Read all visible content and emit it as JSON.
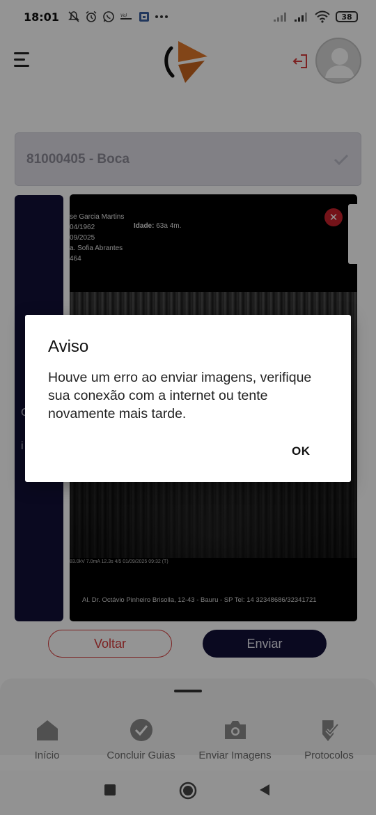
{
  "status_bar": {
    "time": "18:01",
    "battery": "38",
    "icons": [
      "do-not-disturb-icon",
      "alarm-icon",
      "whatsapp-icon",
      "wifi-calling-icon",
      "screen-cast-icon",
      "more-dots-icon",
      "signal-weak-icon",
      "signal-icon",
      "wifi-icon",
      "battery-icon"
    ]
  },
  "header": {
    "menu_icon": "hamburger-menu-icon",
    "logo": "brand-logo",
    "logout_icon": "logout-icon",
    "avatar_icon": "user-avatar-icon"
  },
  "procedure": {
    "title": "81000405 - Boca",
    "check_icon": "check-icon"
  },
  "left_panel": {
    "text1": "C",
    "text2": "i"
  },
  "xray": {
    "patient_name": "se Garcia Martins",
    "birth_date": "04/1962",
    "exam_date": "09/2025",
    "doctor": "a. Sofia Abrantes",
    "code": "464",
    "age_label": "Idade:",
    "age_value": "63a 4m.",
    "params": "83.0kV 7.0mA 12.3s 4/5 01/09/2025 09:32 (T)",
    "footer": "Al. Dr. Octávio Pinheiro Brisolla, 12-43 - Bauru - SP Tel: 14 32348686/32341721",
    "close_symbol": "✕"
  },
  "buttons": {
    "back": "Voltar",
    "send": "Enviar"
  },
  "bottom_nav": [
    {
      "label": "Início",
      "icon": "home-icon"
    },
    {
      "label": "Concluir Guias",
      "icon": "check-circle-icon"
    },
    {
      "label": "Enviar Imagens",
      "icon": "camera-icon"
    },
    {
      "label": "Protocolos",
      "icon": "shield-check-icon"
    }
  ],
  "system_nav": [
    "recents-square-icon",
    "home-circle-icon",
    "back-triangle-icon"
  ],
  "dialog": {
    "title": "Aviso",
    "message": "Houve um erro ao enviar imagens, verifique sua conexão com a internet ou tente novamente mais tarde.",
    "ok": "OK"
  },
  "colors": {
    "navy": "#121038",
    "red": "#d63a3a",
    "logo_orange": "#e0782a",
    "close_red": "#c8222b"
  }
}
